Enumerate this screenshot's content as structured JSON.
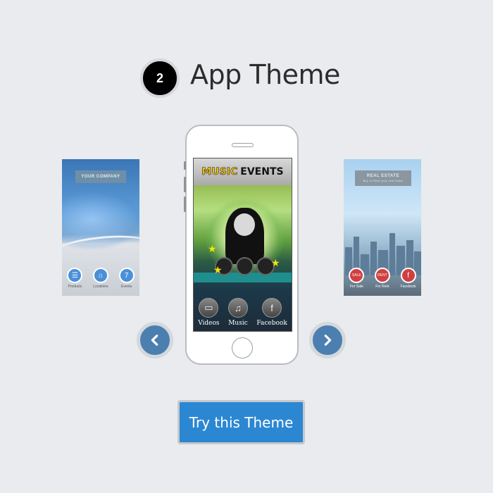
{
  "header": {
    "step": "2",
    "title": "App Theme"
  },
  "themes": {
    "left": {
      "company": "YOUR COMPANY",
      "icons": [
        {
          "label": "Products",
          "glyph": "☰"
        },
        {
          "label": "Locations",
          "glyph": "⌂"
        },
        {
          "label": "Events",
          "glyph": "7"
        }
      ]
    },
    "center": {
      "title_a": "MUSIC",
      "title_b": "EVENTS",
      "icons": [
        {
          "label": "Videos",
          "glyph": "▭"
        },
        {
          "label": "Music",
          "glyph": "♫"
        },
        {
          "label": "Facebook",
          "glyph": "f"
        }
      ]
    },
    "right": {
      "title": "REAL ESTATE",
      "subtitle": "Buy or Rent your next home",
      "icons": [
        {
          "label": "For Sale",
          "glyph": "SALE"
        },
        {
          "label": "For Rent",
          "glyph": "RENT"
        },
        {
          "label": "Facebook",
          "glyph": "f"
        }
      ]
    }
  },
  "controls": {
    "prev_icon": "chevron-left-icon",
    "next_icon": "chevron-right-icon"
  },
  "cta": {
    "label": "Try this Theme"
  }
}
